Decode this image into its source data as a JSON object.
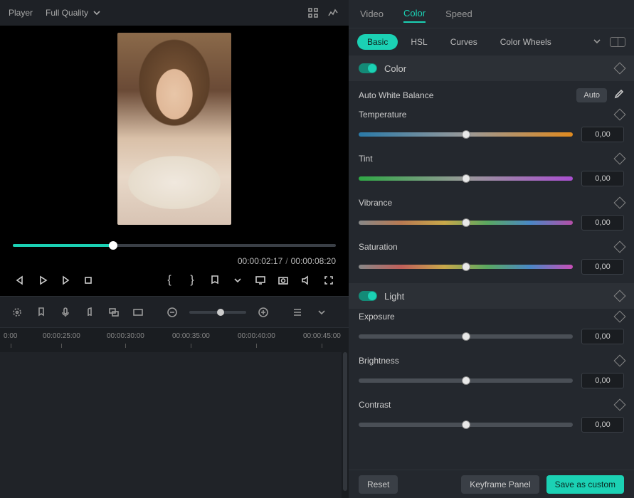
{
  "player": {
    "label": "Player",
    "quality": "Full Quality",
    "current_time": "00:00:02:17",
    "total_time": "00:00:08:20",
    "scrub_percent": 31
  },
  "timeline": {
    "ticks": [
      "0:00",
      "00:00:25:00",
      "00:00:30:00",
      "00:00:35:00",
      "00:00:40:00",
      "00:00:45:00"
    ],
    "zoom_percent": 55
  },
  "tabs": {
    "items": [
      "Video",
      "Color",
      "Speed"
    ],
    "active": "Color"
  },
  "subtabs": {
    "items": [
      "Basic",
      "HSL",
      "Curves",
      "Color Wheels"
    ],
    "active": "Basic"
  },
  "sections": {
    "color": {
      "label": "Color",
      "on": true
    },
    "light": {
      "label": "Light",
      "on": true
    }
  },
  "awb": {
    "label": "Auto White Balance",
    "button": "Auto"
  },
  "sliders": {
    "temperature": {
      "label": "Temperature",
      "value": "0,00"
    },
    "tint": {
      "label": "Tint",
      "value": "0,00"
    },
    "vibrance": {
      "label": "Vibrance",
      "value": "0,00"
    },
    "saturation": {
      "label": "Saturation",
      "value": "0,00"
    },
    "exposure": {
      "label": "Exposure",
      "value": "0,00"
    },
    "brightness": {
      "label": "Brightness",
      "value": "0,00"
    },
    "contrast": {
      "label": "Contrast",
      "value": "0,00"
    }
  },
  "footer": {
    "reset": "Reset",
    "keyframe": "Keyframe Panel",
    "save": "Save as custom"
  }
}
